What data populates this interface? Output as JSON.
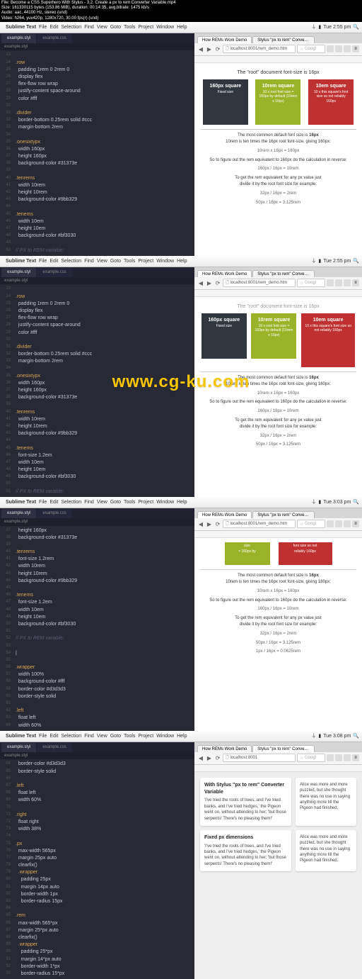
{
  "file_meta": {
    "l1": "File: Become a CSS Superhero With Stylus - 3.2. Create a px to rem Converter Variable.mp4",
    "l2": "Size: 161330115 bytes (153.86 MiB), duration: 00:14:35, avg.bitrate: 1475 kb/s",
    "l3": "Audio: aac, 44100 Hz, stereo (und)",
    "l4": "Video: h264, yuv420p, 1280x720, 30.00 fps(r) (und)"
  },
  "menubar": {
    "app": "Sublime Text",
    "items": [
      "File",
      "Edit",
      "Selection",
      "Find",
      "View",
      "Goto",
      "Tools",
      "Project",
      "Window",
      "Help"
    ],
    "time1": "Tue 2:55 pm",
    "time2": "Tue 2:55 pm",
    "time3": "Tue 3:03 pm",
    "time4": "Tue 3:08 pm"
  },
  "editor": {
    "tab_active": "example.styl",
    "tab_inactive": "example.css",
    "path": "example.styl"
  },
  "code1": [
    {
      "n": "23",
      "c": ""
    },
    {
      "n": "24",
      "c": ".row",
      "cls": "sel"
    },
    {
      "n": "25",
      "c": "  padding 1rem 0 2rem 0",
      "cls": "prop"
    },
    {
      "n": "26",
      "c": "  display flex",
      "cls": "prop"
    },
    {
      "n": "27",
      "c": "  flex-flow row wrap",
      "cls": "prop"
    },
    {
      "n": "28",
      "c": "  justify-content space-around",
      "cls": "prop"
    },
    {
      "n": "29",
      "c": "  color #fff",
      "cls": "prop"
    },
    {
      "n": "30",
      "c": ""
    },
    {
      "n": "31",
      "c": ".divider",
      "cls": "sel"
    },
    {
      "n": "32",
      "c": "  border-bottom 0.25rem solid #ccc",
      "cls": "prop"
    },
    {
      "n": "33",
      "c": "  margin-bottom 2rem",
      "cls": "prop"
    },
    {
      "n": "34",
      "c": ""
    },
    {
      "n": "35",
      "c": ".onesixtypx",
      "cls": "sel"
    },
    {
      "n": "36",
      "c": "  width 160px",
      "cls": "prop"
    },
    {
      "n": "37",
      "c": "  height 160px",
      "cls": "prop"
    },
    {
      "n": "38",
      "c": "  background-color #31373e",
      "cls": "prop"
    },
    {
      "n": "39",
      "c": ""
    },
    {
      "n": "40",
      "c": ".tenrems",
      "cls": "sel"
    },
    {
      "n": "41",
      "c": "  width 10rem",
      "cls": "prop"
    },
    {
      "n": "42",
      "c": "  height 10rem",
      "cls": "prop"
    },
    {
      "n": "43",
      "c": "  background-color #9bb329",
      "cls": "prop"
    },
    {
      "n": "44",
      "c": ""
    },
    {
      "n": "45",
      "c": ".tenems",
      "cls": "sel"
    },
    {
      "n": "46",
      "c": "  width 10em",
      "cls": "prop"
    },
    {
      "n": "47",
      "c": "  height 10em",
      "cls": "prop"
    },
    {
      "n": "48",
      "c": "  background-color #bf3030",
      "cls": "prop"
    },
    {
      "n": "49",
      "c": ""
    },
    {
      "n": "50",
      "c": "// PX to REM variable:",
      "cls": "cmt"
    }
  ],
  "code2": [
    {
      "n": "23",
      "c": ""
    },
    {
      "n": "24",
      "c": ".row",
      "cls": "sel"
    },
    {
      "n": "25",
      "c": "  padding 1rem 0 2rem 0",
      "cls": "prop"
    },
    {
      "n": "26",
      "c": "  display flex",
      "cls": "prop"
    },
    {
      "n": "27",
      "c": "  flex-flow row wrap",
      "cls": "prop"
    },
    {
      "n": "28",
      "c": "  justify-content space-around",
      "cls": "prop"
    },
    {
      "n": "29",
      "c": "  color #fff",
      "cls": "prop"
    },
    {
      "n": "30",
      "c": ""
    },
    {
      "n": "31",
      "c": ".divider",
      "cls": "sel"
    },
    {
      "n": "32",
      "c": "  border-bottom 0.25rem solid #ccc",
      "cls": "prop"
    },
    {
      "n": "33",
      "c": "  margin-bottom 2rem",
      "cls": "prop"
    },
    {
      "n": "34",
      "c": ""
    },
    {
      "n": "35",
      "c": ".onesixtypx",
      "cls": "sel"
    },
    {
      "n": "36",
      "c": "  width 160px",
      "cls": "prop"
    },
    {
      "n": "37",
      "c": "  height 160px",
      "cls": "prop"
    },
    {
      "n": "38",
      "c": "  background-color #31373e",
      "cls": "prop"
    },
    {
      "n": "39",
      "c": ""
    },
    {
      "n": "40",
      "c": ".tenrems",
      "cls": "sel"
    },
    {
      "n": "41",
      "c": "  width 10rem",
      "cls": "prop"
    },
    {
      "n": "42",
      "c": "  height 10rem",
      "cls": "prop"
    },
    {
      "n": "43",
      "c": "  background-color #9bb329",
      "cls": "prop"
    },
    {
      "n": "44",
      "c": ""
    },
    {
      "n": "45",
      "c": ".tenems",
      "cls": "sel"
    },
    {
      "n": "46",
      "c": "  font-size 1.2em",
      "cls": "prop"
    },
    {
      "n": "47",
      "c": "  width 10em",
      "cls": "prop"
    },
    {
      "n": "48",
      "c": "  height 10em",
      "cls": "prop"
    },
    {
      "n": "49",
      "c": "  background-color #bf3030",
      "cls": "prop"
    },
    {
      "n": "50",
      "c": ""
    },
    {
      "n": "51",
      "c": "// PX to REM variable:",
      "cls": "cmt"
    }
  ],
  "code3": [
    {
      "n": "37",
      "c": "  height 160px",
      "cls": "prop"
    },
    {
      "n": "38",
      "c": "  background-color #31373e",
      "cls": "prop"
    },
    {
      "n": "39",
      "c": ""
    },
    {
      "n": "40",
      "c": ".tenrems",
      "cls": "sel"
    },
    {
      "n": "41",
      "c": "  font-size 1.2rem",
      "cls": "prop"
    },
    {
      "n": "42",
      "c": "  width 10rem",
      "cls": "prop"
    },
    {
      "n": "43",
      "c": "  height 10rem",
      "cls": "prop"
    },
    {
      "n": "44",
      "c": "  background-color #9bb329",
      "cls": "prop"
    },
    {
      "n": "45",
      "c": ""
    },
    {
      "n": "46",
      "c": ".tenems",
      "cls": "sel"
    },
    {
      "n": "47",
      "c": "  font-size 1.2em",
      "cls": "prop"
    },
    {
      "n": "48",
      "c": "  width 10em",
      "cls": "prop"
    },
    {
      "n": "49",
      "c": "  height 10em",
      "cls": "prop"
    },
    {
      "n": "50",
      "c": "  background-color #bf3030",
      "cls": "prop"
    },
    {
      "n": "51",
      "c": ""
    },
    {
      "n": "52",
      "c": "// PX to REM variable:",
      "cls": "cmt"
    },
    {
      "n": "53",
      "c": ""
    },
    {
      "n": "54",
      "c": "|",
      "cls": "prop"
    },
    {
      "n": "55",
      "c": ""
    },
    {
      "n": "56",
      "c": ".wrapper",
      "cls": "sel"
    },
    {
      "n": "57",
      "c": "  width 100%",
      "cls": "prop"
    },
    {
      "n": "58",
      "c": "  background-color #fff",
      "cls": "prop"
    },
    {
      "n": "59",
      "c": "  border-color #d3d3d3",
      "cls": "prop"
    },
    {
      "n": "60",
      "c": "  border-style solid",
      "cls": "prop"
    },
    {
      "n": "61",
      "c": ""
    },
    {
      "n": "62",
      "c": ".left",
      "cls": "sel"
    },
    {
      "n": "63",
      "c": "  float left",
      "cls": "prop"
    },
    {
      "n": "64",
      "c": "  width 60%",
      "cls": "prop"
    }
  ],
  "code4": [
    {
      "n": "64",
      "c": "  border-color #d3d3d3",
      "cls": "prop"
    },
    {
      "n": "65",
      "c": "  border-style solid",
      "cls": "prop"
    },
    {
      "n": "66",
      "c": ""
    },
    {
      "n": "67",
      "c": ".left",
      "cls": "sel"
    },
    {
      "n": "68",
      "c": "  float left",
      "cls": "prop"
    },
    {
      "n": "69",
      "c": "  width 60%",
      "cls": "prop"
    },
    {
      "n": "70",
      "c": ""
    },
    {
      "n": "71",
      "c": ".right",
      "cls": "sel"
    },
    {
      "n": "72",
      "c": "  float right",
      "cls": "prop"
    },
    {
      "n": "73",
      "c": "  width 38%",
      "cls": "prop"
    },
    {
      "n": "74",
      "c": ""
    },
    {
      "n": "75",
      "c": ".px",
      "cls": "sel"
    },
    {
      "n": "76",
      "c": "  max-width 565px",
      "cls": "prop"
    },
    {
      "n": "77",
      "c": "  margin 25px auto",
      "cls": "prop"
    },
    {
      "n": "78",
      "c": "  clearfix()",
      "cls": "prop"
    },
    {
      "n": "79",
      "c": "  .wrapper",
      "cls": "sel"
    },
    {
      "n": "80",
      "c": "    padding 25px",
      "cls": "prop"
    },
    {
      "n": "81",
      "c": "    margin 14px auto",
      "cls": "prop"
    },
    {
      "n": "82",
      "c": "    border-width 1px",
      "cls": "prop"
    },
    {
      "n": "83",
      "c": "    border-radius 15px",
      "cls": "prop"
    },
    {
      "n": "84",
      "c": ""
    },
    {
      "n": "85",
      "c": ".rem",
      "cls": "sel"
    },
    {
      "n": "86",
      "c": "  max-width 565*px",
      "cls": "prop"
    },
    {
      "n": "87",
      "c": "  margin 25*px auto",
      "cls": "prop"
    },
    {
      "n": "88",
      "c": "  clearfix()",
      "cls": "prop"
    },
    {
      "n": "89",
      "c": "  .wrapper",
      "cls": "sel"
    },
    {
      "n": "90",
      "c": "    padding 25*px",
      "cls": "prop"
    },
    {
      "n": "91",
      "c": "    margin 14*px auto",
      "cls": "prop"
    },
    {
      "n": "92",
      "c": "    border-width 1*px",
      "cls": "prop"
    },
    {
      "n": "93",
      "c": "    border-radius 15*px",
      "cls": "prop"
    }
  ],
  "chrome": {
    "tab1": "How REMs Work Demo",
    "tab2": "Stylus \"px to rem\" Convert...",
    "url_demo": "localhost:8001/rem_demo.htm",
    "url_root": "localhost:8001",
    "search": "Googl"
  },
  "demo": {
    "intro": "The \"root\" document font-size is 16px",
    "sq1_t": "160px square",
    "sq1_s": "Fixed size",
    "sq2_t": "10rem square",
    "sq2_s": "10 x root font size = 160px by default (10rem x 16px)",
    "sq3_t": "10em square",
    "sq3_s": "10 x this square's font size so not reliably 160px",
    "exp_l1": "The most common default font size is ",
    "exp_l1b": "16px",
    "exp_l2": "10rem is ten times the 16px root font-size, giving 160px:",
    "exp_m1": "10rem  x  16px  =  160px",
    "exp_l3": "So to figure out the rem equivalent to 160px do the calculation in reverse:",
    "exp_m2": "160px  /  16px  =  10rem",
    "exp_l4": "To get the rem equivalent for any px value just",
    "exp_l5": "divide it by the root font size for example:",
    "exp_m3": "32px / 16px = 2rem",
    "exp_m4": "50px / 16px = 3.125rem",
    "exp_m5": "1px / 16px = 0.0625rem"
  },
  "demo3": {
    "sq2_partial1": "size",
    "sq2_partial2": "= 160px by",
    "sq3_partial1": "font size so not",
    "sq3_partial2": "reliably 160px"
  },
  "cards": {
    "c1_title": "With Stylus \"px to rem\" Converter Variable",
    "c1_body": "'I've tried the roots of trees, and I've tried banks, and I've tried hedges,' the Pigeon went on, without attending to her; 'but those serpents! There's no pleasing them!'",
    "c2_body": "Alice was more and more puzzled, but she thought there was no use in saying anything more till the Pigeon had finished.",
    "c3_title": "Fixed px dimensions",
    "c3_body": "'I've tried the roots of trees, and I've tried banks, and I've tried hedges,' the Pigeon went on, without attending to her; 'but those serpents! There's no pleasing them!'",
    "c4_body": "Alice was more and more puzzled, but she thought there was no use in saying anything more till the Pigeon had finished."
  },
  "watermark": "www.cg-ku.com"
}
